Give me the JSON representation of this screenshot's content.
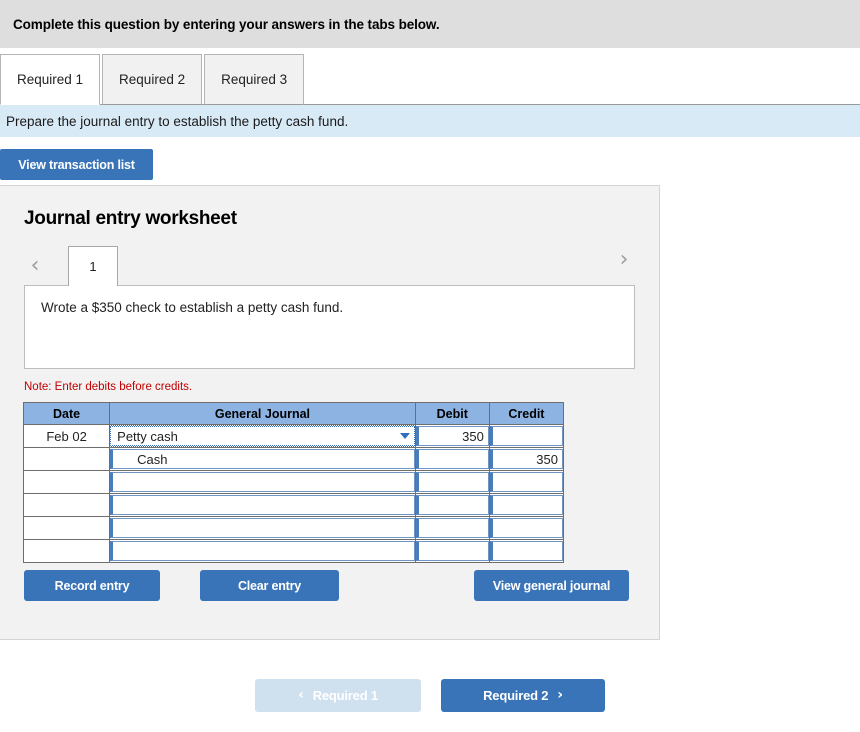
{
  "top_bar": {
    "instruction": "Complete this question by entering your answers in the tabs below."
  },
  "tabs": [
    {
      "label": "Required 1",
      "active": true
    },
    {
      "label": "Required 2",
      "active": false
    },
    {
      "label": "Required 3",
      "active": false
    }
  ],
  "sub_instruction": "Prepare the journal entry to establish the petty cash fund.",
  "toolbar": {
    "view_transaction_list": "View transaction list"
  },
  "worksheet": {
    "title": "Journal entry worksheet",
    "prev_icon": "chevron-left-icon",
    "next_icon": "chevron-right-icon",
    "page_tabs": [
      {
        "label": "1",
        "active": true
      }
    ],
    "description": "Wrote a $350 check to establish a petty cash fund.",
    "note": "Note: Enter debits before credits.",
    "table": {
      "headers": [
        "Date",
        "General Journal",
        "Debit",
        "Credit"
      ],
      "rows": [
        {
          "date": "Feb 02",
          "account": "Petty cash",
          "indent": false,
          "focused": true,
          "debit": "350",
          "credit": ""
        },
        {
          "date": "",
          "account": "Cash",
          "indent": true,
          "focused": false,
          "debit": "",
          "credit": "350"
        },
        {
          "date": "",
          "account": "",
          "indent": false,
          "focused": false,
          "debit": "",
          "credit": ""
        },
        {
          "date": "",
          "account": "",
          "indent": false,
          "focused": false,
          "debit": "",
          "credit": ""
        },
        {
          "date": "",
          "account": "",
          "indent": false,
          "focused": false,
          "debit": "",
          "credit": ""
        },
        {
          "date": "",
          "account": "",
          "indent": false,
          "focused": false,
          "debit": "",
          "credit": ""
        }
      ]
    },
    "actions": {
      "record_entry": "Record entry",
      "clear_entry": "Clear entry",
      "view_general_journal": "View general journal"
    }
  },
  "footer": {
    "prev": {
      "label": "Required 1",
      "icon": "chevron-left-icon",
      "disabled": true
    },
    "next": {
      "label": "Required 2",
      "icon": "chevron-right-icon",
      "disabled": false
    }
  },
  "colors": {
    "button_blue": "#3a74b8",
    "button_blue_disabled": "#cfe0ef",
    "table_header_blue": "#8db3e2",
    "top_bar_gray": "#dedede",
    "sub_band_blue": "#d9eaf7",
    "panel_gray": "#f2f2f2",
    "note_red": "#c00000",
    "cell_border_blue": "#4a7ebb"
  }
}
